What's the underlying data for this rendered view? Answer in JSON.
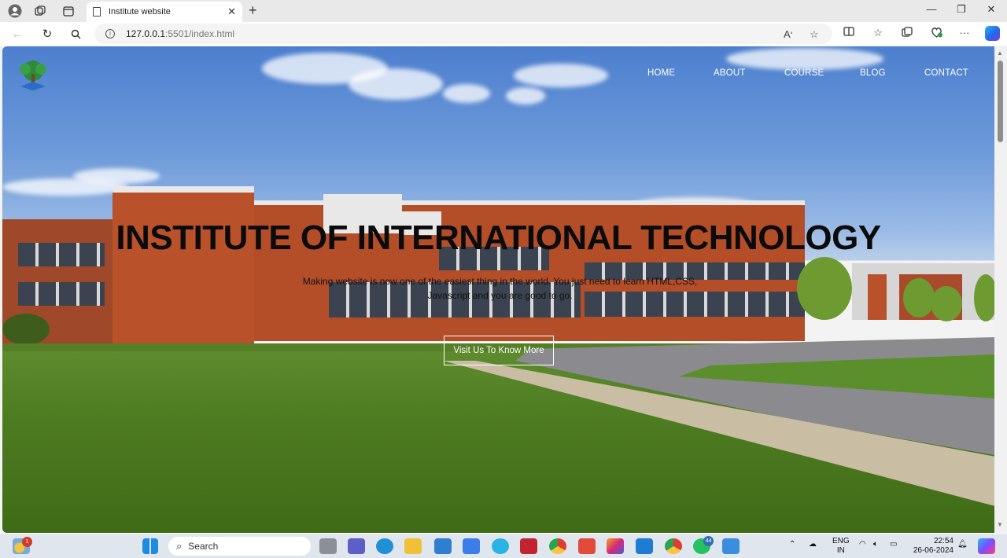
{
  "browser": {
    "tab_title": "Institute website",
    "url_host": "127.0.0.1",
    "url_rest": ":5501/index.html"
  },
  "site": {
    "nav": [
      "HOME",
      "ABOUT",
      "COURSE",
      "BLOG",
      "CONTACT"
    ],
    "headline": "INSTITUTE OF INTERNATIONAL TECHNOLOGY",
    "subtitle": "Making website is now one of the easiest thing in the world. You just need to learn HTML,CSS, Javascript and you are good to go.",
    "cta_label": "Visit Us To Know More"
  },
  "taskbar": {
    "search_placeholder": "Search",
    "weather_badge": "1",
    "whatsapp_badge": "44",
    "language": "ENG",
    "region": "IN",
    "time": "22:54",
    "date": "26-06-2024"
  }
}
